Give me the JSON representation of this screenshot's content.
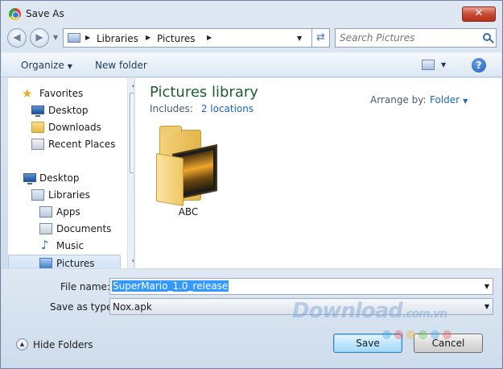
{
  "window": {
    "title": "Save As",
    "close_glyph": "✕"
  },
  "nav": {
    "back_glyph": "◀",
    "forward_glyph": "▶"
  },
  "address": {
    "crumbs": [
      "Libraries",
      "Pictures"
    ]
  },
  "search": {
    "placeholder": "Search Pictures"
  },
  "toolbar": {
    "organize": "Organize",
    "new_folder": "New folder",
    "help_glyph": "?"
  },
  "sidebar": {
    "items": [
      {
        "label": "Favorites",
        "icon": "star-icon"
      },
      {
        "label": "Desktop",
        "icon": "desktop-icon"
      },
      {
        "label": "Downloads",
        "icon": "downloads-folder-icon"
      },
      {
        "label": "Recent Places",
        "icon": "recent-places-icon"
      },
      {
        "label": "Desktop",
        "icon": "desktop-icon"
      },
      {
        "label": "Libraries",
        "icon": "libraries-icon"
      },
      {
        "label": "Apps",
        "icon": "apps-icon"
      },
      {
        "label": "Documents",
        "icon": "documents-icon"
      },
      {
        "label": "Music",
        "icon": "music-icon"
      },
      {
        "label": "Pictures",
        "icon": "pictures-icon",
        "selected": true
      }
    ]
  },
  "content": {
    "library_title": "Pictures library",
    "includes_label": "Includes:",
    "includes_link": "2 locations",
    "arrange_label": "Arrange by:",
    "arrange_value": "Folder",
    "items": [
      {
        "label": "ABC",
        "icon": "video-folder-icon"
      }
    ]
  },
  "form": {
    "file_name_label": "File name:",
    "file_name_value": "SuperMario_1.0_release",
    "save_type_label": "Save as type:",
    "save_type_value": "Nox.apk"
  },
  "footer": {
    "hide_folders": "Hide Folders",
    "save": "Save",
    "cancel": "Cancel"
  },
  "watermark": {
    "text": "Download",
    "suffix": ".com.vn"
  },
  "colors": {
    "library_title": "#1e5d2e",
    "link": "#1a67c2",
    "selection": "#3399ff"
  }
}
